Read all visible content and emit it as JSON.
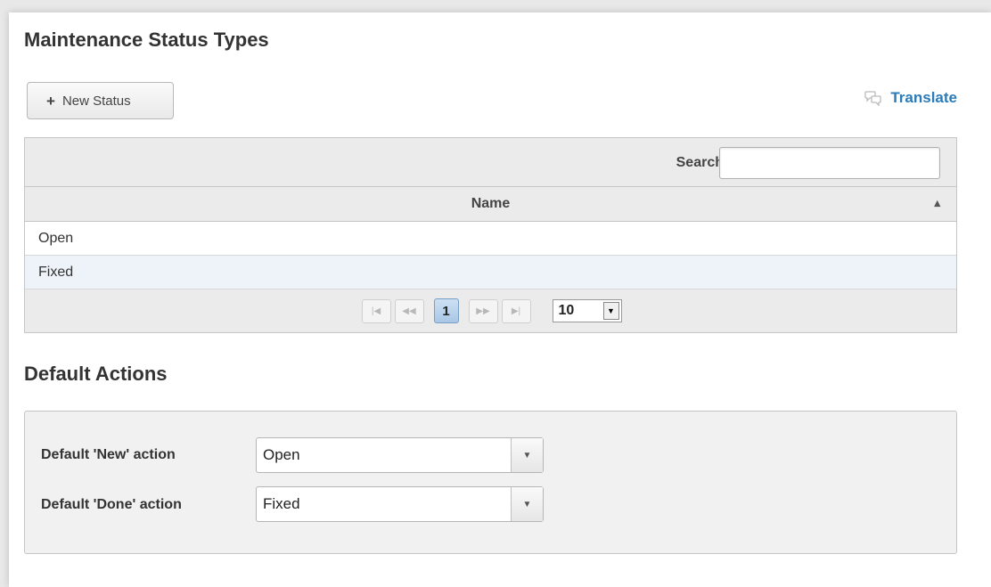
{
  "page": {
    "title": "Maintenance Status Types",
    "new_button_label": "New Status",
    "translate_label": "Translate"
  },
  "table": {
    "search_label": "Search",
    "search_value": "",
    "column_name": "Name",
    "rows": [
      "Open",
      "Fixed"
    ],
    "paginator": {
      "first_icon": "first-page-icon",
      "prev_icon": "prev-page-icon",
      "next_icon": "next-page-icon",
      "last_icon": "last-page-icon",
      "current_page": "1",
      "rows_per_page": "10"
    }
  },
  "defaults": {
    "title": "Default Actions",
    "new_action_label": "Default 'New' action",
    "new_action_value": "Open",
    "done_action_label": "Default 'Done' action",
    "done_action_value": "Fixed"
  },
  "colors": {
    "link": "#2a7bb8",
    "active_page": "#a9c7e6",
    "alt_row": "#eef3fa"
  }
}
